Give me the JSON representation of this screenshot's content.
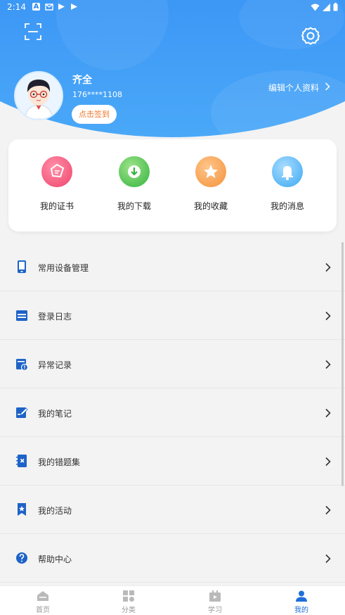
{
  "status_bar": {
    "time": "2:14",
    "left_icons": [
      "a-box-icon",
      "mail-icon",
      "play-icon",
      "play-icon"
    ],
    "right_icons": [
      "wifi-icon",
      "signal-icon",
      "battery-icon"
    ]
  },
  "header": {
    "scan_icon": "scan-icon",
    "settings_icon": "gear-icon",
    "colors": {
      "gradient_top": "#2e86f2",
      "gradient_bottom": "#4aa8f8"
    }
  },
  "profile": {
    "name": "齐全",
    "phone": "176****1108",
    "checkin_label": "点击签到",
    "edit_label": "编辑个人资料",
    "checkin_color": "#f07a2e"
  },
  "quick_actions": [
    {
      "label": "我的证书",
      "icon": "certificate-icon",
      "color": "#f0436b"
    },
    {
      "label": "我的下载",
      "icon": "download-icon",
      "color": "#32b43d"
    },
    {
      "label": "我的收藏",
      "icon": "star-icon",
      "color": "#f3923a"
    },
    {
      "label": "我的消息",
      "icon": "bell-icon",
      "color": "#3aa8f2"
    }
  ],
  "menu": [
    {
      "label": "常用设备管理",
      "icon": "phone-device-icon"
    },
    {
      "label": "登录日志",
      "icon": "log-icon"
    },
    {
      "label": "异常记录",
      "icon": "alert-record-icon"
    },
    {
      "label": "我的笔记",
      "icon": "note-icon"
    },
    {
      "label": "我的错题集",
      "icon": "wrong-questions-icon"
    },
    {
      "label": "我的活动",
      "icon": "activity-bookmark-icon"
    },
    {
      "label": "帮助中心",
      "icon": "help-icon"
    }
  ],
  "tabbar": {
    "active_index": 3,
    "active_color": "#1e6fd9",
    "tabs": [
      {
        "label": "首页",
        "icon": "home-icon"
      },
      {
        "label": "分类",
        "icon": "category-icon"
      },
      {
        "label": "学习",
        "icon": "study-icon"
      },
      {
        "label": "我的",
        "icon": "profile-icon"
      }
    ]
  }
}
